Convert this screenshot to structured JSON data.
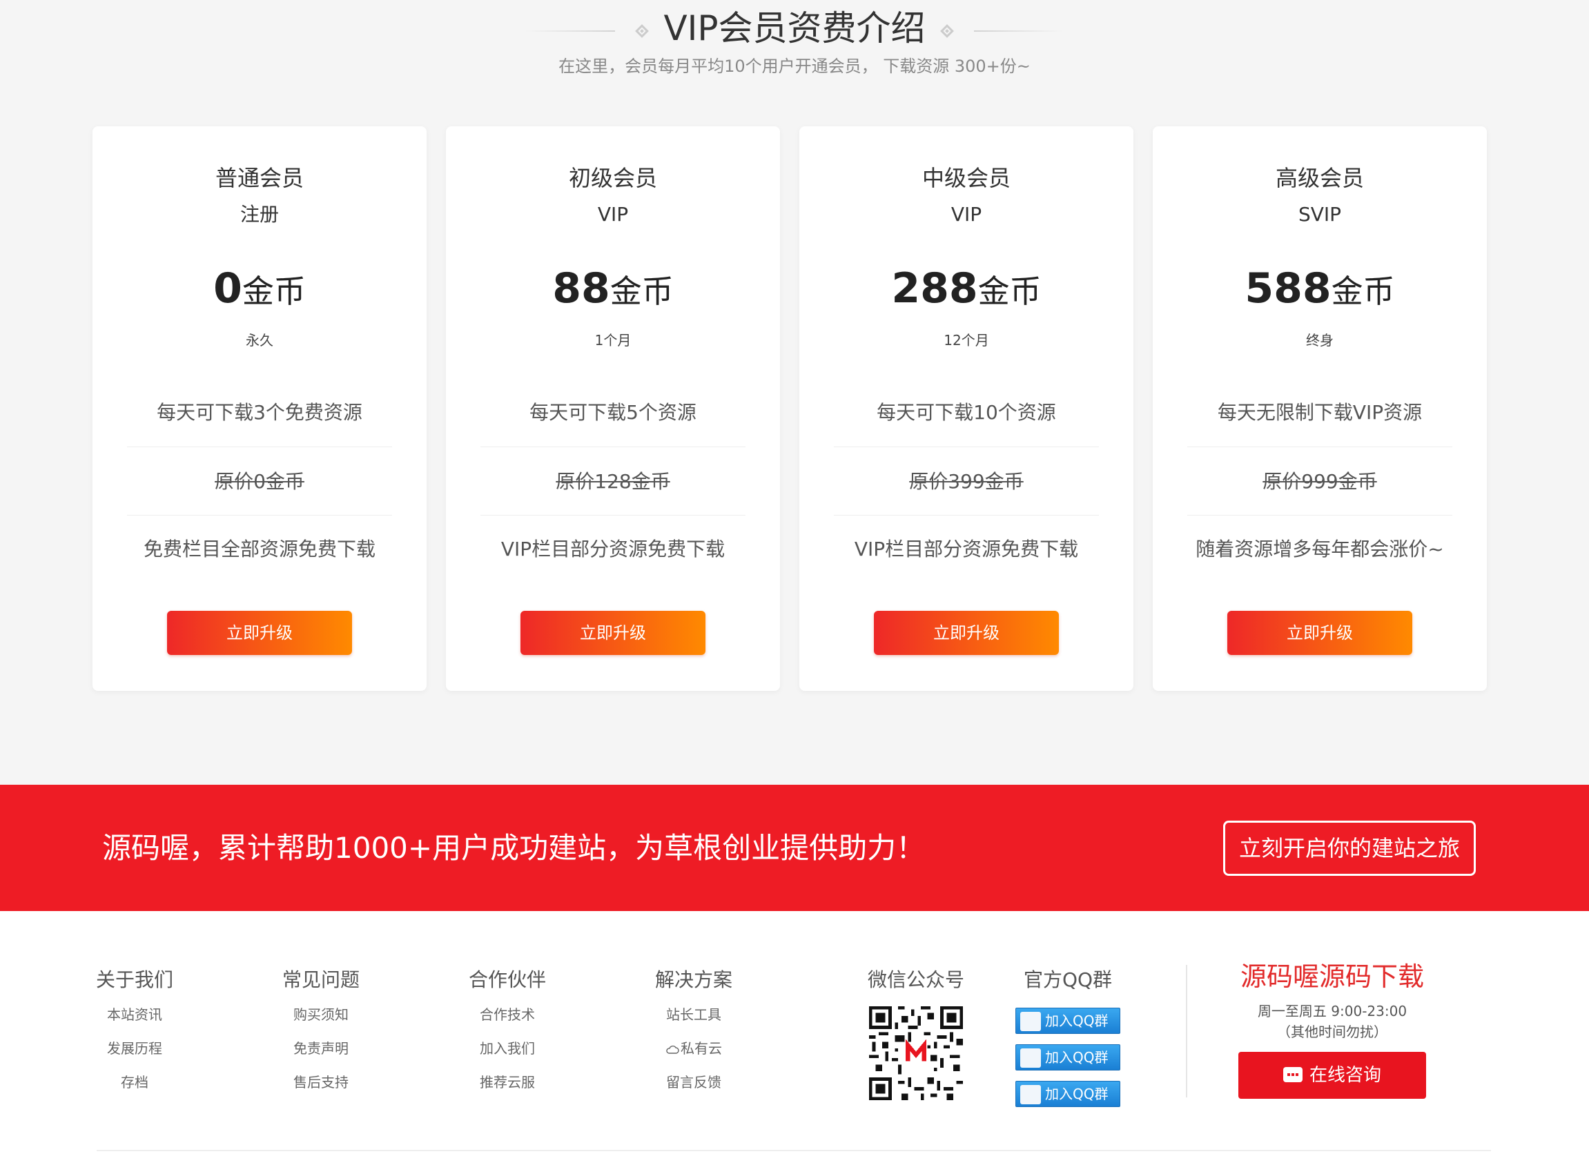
{
  "section": {
    "title": "VIP会员资费介绍",
    "subtitle": "在这里，会员每月平均10个用户开通会员， 下载资源 300+份~"
  },
  "plans": [
    {
      "level": "普通会员",
      "grade": "注册",
      "price": "0",
      "unit": "金币",
      "duration": "永久",
      "feature": "每天可下载3个免费资源",
      "original": "原价0金币",
      "note": "免费栏目全部资源免费下载",
      "button": "立即升级"
    },
    {
      "level": "初级会员",
      "grade": "VIP",
      "price": "88",
      "unit": "金币",
      "duration": "1个月",
      "feature": "每天可下载5个资源",
      "original": "原价128金币",
      "note": "VIP栏目部分资源免费下载",
      "button": "立即升级"
    },
    {
      "level": "中级会员",
      "grade": "VIP",
      "price": "288",
      "unit": "金币",
      "duration": "12个月",
      "feature": "每天可下载10个资源",
      "original": "原价399金币",
      "note": "VIP栏目部分资源免费下载",
      "button": "立即升级"
    },
    {
      "level": "高级会员",
      "grade": "SVIP",
      "price": "588",
      "unit": "金币",
      "duration": "终身",
      "feature": "每天无限制下载VIP资源",
      "original": "原价999金币",
      "note": "随着资源增多每年都会涨价~",
      "button": "立即升级"
    }
  ],
  "banner": {
    "slogan": "源码喔，累计帮助1000+用户成功建站，为草根创业提供助力！",
    "cta": "立刻开启你的建站之旅"
  },
  "footer": {
    "columns": [
      {
        "title": "关于我们",
        "links": [
          "本站资讯",
          "发展历程",
          "存档"
        ]
      },
      {
        "title": "常见问题",
        "links": [
          "购买须知",
          "免责声明",
          "售后支持"
        ]
      },
      {
        "title": "合作伙伴",
        "links": [
          "合作技术",
          "加入我们",
          "推荐云服"
        ]
      },
      {
        "title": "解决方案",
        "links": [
          "站长工具",
          "私有云",
          "留言反馈"
        ]
      }
    ],
    "wechat_title": "微信公众号",
    "qq_title": "官方QQ群",
    "qq_buttons": [
      "加入QQ群",
      "加入QQ群",
      "加入QQ群"
    ],
    "brand_title": "源码喔源码下载",
    "hours": "周一至周五 9:00-23:00",
    "hours_note": "（其他时间勿扰）",
    "consult": "在线咨询"
  },
  "colors": {
    "accent_red": "#ee1c25",
    "button_gradient_start": "#ee2828",
    "button_gradient_end": "#ff8a00",
    "qq_blue": "#1a7fd4"
  },
  "icons": [
    "cloud-icon",
    "qr-code-icon",
    "qq-avatar-icon",
    "chat-icon"
  ]
}
